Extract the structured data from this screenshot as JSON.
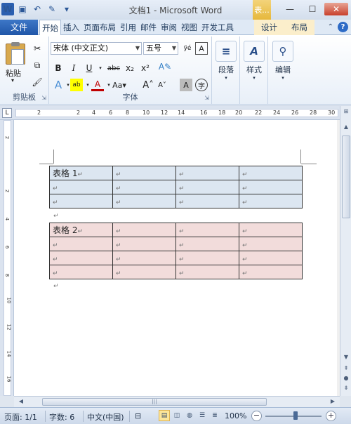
{
  "titlebar": {
    "title": "文档1 - Microsoft Word",
    "context_tab_label": "表..."
  },
  "tabs": {
    "file": "文件",
    "items": [
      "开始",
      "插入",
      "页面布局",
      "引用",
      "邮件",
      "审阅",
      "视图",
      "开发工具"
    ],
    "active": "开始",
    "context_items": [
      "设计",
      "布局"
    ]
  },
  "ribbon": {
    "clipboard": {
      "paste": "粘贴",
      "label": "剪贴板"
    },
    "font": {
      "font_name": "宋体 (中文正文)",
      "font_size": "五号",
      "label": "字体",
      "buttons": [
        "B",
        "I",
        "U",
        "abc",
        "x₂",
        "x²"
      ]
    },
    "paragraph": {
      "label": "段落"
    },
    "styles": {
      "label": "样式"
    },
    "editing": {
      "label": "编辑"
    }
  },
  "ruler": {
    "h_numbers": [
      "2",
      "",
      "2",
      "4",
      "6",
      "8",
      "10",
      "12",
      "14",
      "16",
      "18",
      "20",
      "22",
      "24",
      "26",
      "28",
      "30"
    ],
    "v_numbers": [
      "2",
      "",
      "2",
      "4",
      "6",
      "8",
      "10",
      "12",
      "14",
      "16",
      "18"
    ]
  },
  "document": {
    "table1": {
      "color": "#dce6f1",
      "rows": [
        [
          "表格 1",
          "",
          "",
          ""
        ],
        [
          "",
          "",
          "",
          ""
        ],
        [
          "",
          "",
          "",
          ""
        ]
      ]
    },
    "table2": {
      "color": "#f2dcdb",
      "rows": [
        [
          "表格 2",
          "",
          "",
          ""
        ],
        [
          "",
          "",
          "",
          ""
        ],
        [
          "",
          "",
          "",
          ""
        ],
        [
          "",
          "",
          "",
          ""
        ]
      ]
    },
    "para_mark": "↵"
  },
  "statusbar": {
    "page": "页面: 1/1",
    "words": "字数: 6",
    "language": "中文(中国)",
    "zoom": "100%"
  }
}
